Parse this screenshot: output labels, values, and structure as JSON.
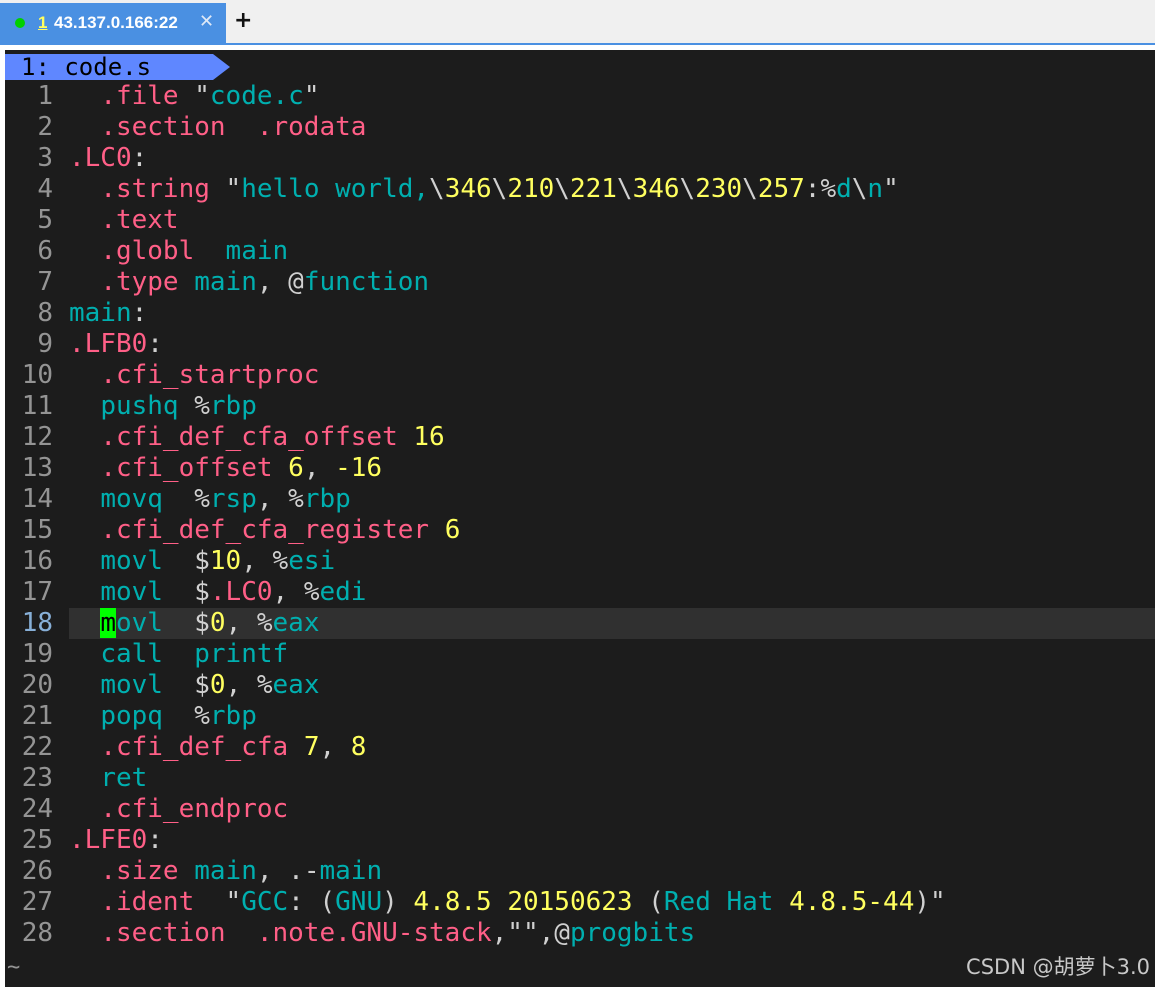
{
  "tab": {
    "number": "1",
    "host": "43.137.0.166:22",
    "close_glyph": "✕",
    "new_tab_glyph": "+",
    "status_color": "#00d000"
  },
  "buffer": {
    "name": "1: code.s"
  },
  "editor": {
    "current_line": 18,
    "empty_line_marker": "~"
  },
  "lines": [
    {
      "n": "1",
      "segs": [
        [
          "  ",
          "plain"
        ],
        [
          ".file",
          "dir"
        ],
        [
          " \"",
          "plain"
        ],
        [
          "code.c",
          "str"
        ],
        [
          "\"",
          "plain"
        ]
      ]
    },
    {
      "n": "2",
      "segs": [
        [
          "  ",
          "plain"
        ],
        [
          ".section  .rodata",
          "dir"
        ]
      ]
    },
    {
      "n": "3",
      "segs": [
        [
          ".LC0",
          "lbl"
        ],
        [
          ":",
          "plain"
        ]
      ]
    },
    {
      "n": "4",
      "segs": [
        [
          "  ",
          "plain"
        ],
        [
          ".string",
          "dir"
        ],
        [
          " \"",
          "plain"
        ],
        [
          "hello world,",
          "str"
        ],
        [
          "\\",
          "plain"
        ],
        [
          "346",
          "num"
        ],
        [
          "\\",
          "plain"
        ],
        [
          "210",
          "num"
        ],
        [
          "\\",
          "plain"
        ],
        [
          "221",
          "num"
        ],
        [
          "\\",
          "plain"
        ],
        [
          "346",
          "num"
        ],
        [
          "\\",
          "plain"
        ],
        [
          "230",
          "num"
        ],
        [
          "\\",
          "plain"
        ],
        [
          "257",
          "num"
        ],
        [
          ":%",
          "plain"
        ],
        [
          "d",
          "str"
        ],
        [
          "\\",
          "plain"
        ],
        [
          "n",
          "str"
        ],
        [
          "\"",
          "plain"
        ]
      ]
    },
    {
      "n": "5",
      "segs": [
        [
          "  ",
          "plain"
        ],
        [
          ".text",
          "dir"
        ]
      ]
    },
    {
      "n": "6",
      "segs": [
        [
          "  ",
          "plain"
        ],
        [
          ".globl",
          "dir"
        ],
        [
          "  ",
          "plain"
        ],
        [
          "main",
          "str"
        ]
      ]
    },
    {
      "n": "7",
      "segs": [
        [
          "  ",
          "plain"
        ],
        [
          ".type",
          "dir"
        ],
        [
          " ",
          "plain"
        ],
        [
          "main",
          "str"
        ],
        [
          ", @",
          "plain"
        ],
        [
          "function",
          "str"
        ]
      ]
    },
    {
      "n": "8",
      "segs": [
        [
          "main",
          "str"
        ],
        [
          ":",
          "plain"
        ]
      ]
    },
    {
      "n": "9",
      "segs": [
        [
          ".LFB0",
          "lbl"
        ],
        [
          ":",
          "plain"
        ]
      ]
    },
    {
      "n": "10",
      "segs": [
        [
          "  ",
          "plain"
        ],
        [
          ".cfi_startproc",
          "dir"
        ]
      ]
    },
    {
      "n": "11",
      "segs": [
        [
          "  ",
          "plain"
        ],
        [
          "pushq",
          "ins"
        ],
        [
          " %",
          "plain"
        ],
        [
          "rbp",
          "reg"
        ]
      ]
    },
    {
      "n": "12",
      "segs": [
        [
          "  ",
          "plain"
        ],
        [
          ".cfi_def_cfa_offset",
          "dir"
        ],
        [
          " ",
          "plain"
        ],
        [
          "16",
          "num"
        ]
      ]
    },
    {
      "n": "13",
      "segs": [
        [
          "  ",
          "plain"
        ],
        [
          ".cfi_offset",
          "dir"
        ],
        [
          " ",
          "plain"
        ],
        [
          "6",
          "num"
        ],
        [
          ", ",
          "plain"
        ],
        [
          "-16",
          "num"
        ]
      ]
    },
    {
      "n": "14",
      "segs": [
        [
          "  ",
          "plain"
        ],
        [
          "movq",
          "ins"
        ],
        [
          "  %",
          "plain"
        ],
        [
          "rsp",
          "reg"
        ],
        [
          ", %",
          "plain"
        ],
        [
          "rbp",
          "reg"
        ]
      ]
    },
    {
      "n": "15",
      "segs": [
        [
          "  ",
          "plain"
        ],
        [
          ".cfi_def_cfa_register",
          "dir"
        ],
        [
          " ",
          "plain"
        ],
        [
          "6",
          "num"
        ]
      ]
    },
    {
      "n": "16",
      "segs": [
        [
          "  ",
          "plain"
        ],
        [
          "movl",
          "ins"
        ],
        [
          "  $",
          "plain"
        ],
        [
          "10",
          "num"
        ],
        [
          ", %",
          "plain"
        ],
        [
          "esi",
          "reg"
        ]
      ]
    },
    {
      "n": "17",
      "segs": [
        [
          "  ",
          "plain"
        ],
        [
          "movl",
          "ins"
        ],
        [
          "  $",
          "plain"
        ],
        [
          ".LC0",
          "lbl"
        ],
        [
          ", %",
          "plain"
        ],
        [
          "edi",
          "reg"
        ]
      ]
    },
    {
      "n": "18",
      "segs": [
        [
          "  ",
          "plain"
        ],
        [
          "m",
          "cursor"
        ],
        [
          "ovl",
          "ins"
        ],
        [
          "  $",
          "plain"
        ],
        [
          "0",
          "num"
        ],
        [
          ", %",
          "plain"
        ],
        [
          "eax",
          "reg"
        ]
      ]
    },
    {
      "n": "19",
      "segs": [
        [
          "  ",
          "plain"
        ],
        [
          "call",
          "ins"
        ],
        [
          "  ",
          "plain"
        ],
        [
          "printf",
          "str"
        ]
      ]
    },
    {
      "n": "20",
      "segs": [
        [
          "  ",
          "plain"
        ],
        [
          "movl",
          "ins"
        ],
        [
          "  $",
          "plain"
        ],
        [
          "0",
          "num"
        ],
        [
          ", %",
          "plain"
        ],
        [
          "eax",
          "reg"
        ]
      ]
    },
    {
      "n": "21",
      "segs": [
        [
          "  ",
          "plain"
        ],
        [
          "popq",
          "ins"
        ],
        [
          "  %",
          "plain"
        ],
        [
          "rbp",
          "reg"
        ]
      ]
    },
    {
      "n": "22",
      "segs": [
        [
          "  ",
          "plain"
        ],
        [
          ".cfi_def_cfa",
          "dir"
        ],
        [
          " ",
          "plain"
        ],
        [
          "7",
          "num"
        ],
        [
          ", ",
          "plain"
        ],
        [
          "8",
          "num"
        ]
      ]
    },
    {
      "n": "23",
      "segs": [
        [
          "  ",
          "plain"
        ],
        [
          "ret",
          "ins"
        ]
      ]
    },
    {
      "n": "24",
      "segs": [
        [
          "  ",
          "plain"
        ],
        [
          ".cfi_endproc",
          "dir"
        ]
      ]
    },
    {
      "n": "25",
      "segs": [
        [
          ".LFE0",
          "lbl"
        ],
        [
          ":",
          "plain"
        ]
      ]
    },
    {
      "n": "26",
      "segs": [
        [
          "  ",
          "plain"
        ],
        [
          ".size",
          "dir"
        ],
        [
          " ",
          "plain"
        ],
        [
          "main",
          "str"
        ],
        [
          ", .-",
          "plain"
        ],
        [
          "main",
          "str"
        ]
      ]
    },
    {
      "n": "27",
      "segs": [
        [
          "  ",
          "plain"
        ],
        [
          ".ident",
          "dir"
        ],
        [
          "  \"",
          "plain"
        ],
        [
          "GCC",
          "str"
        ],
        [
          ": (",
          "plain"
        ],
        [
          "GNU",
          "str"
        ],
        [
          ") ",
          "plain"
        ],
        [
          "4.8.5 20150623",
          "num"
        ],
        [
          " (",
          "plain"
        ],
        [
          "Red Hat",
          "str"
        ],
        [
          " ",
          "plain"
        ],
        [
          "4.8.5-44",
          "num"
        ],
        [
          ")\"",
          "plain"
        ]
      ]
    },
    {
      "n": "28",
      "segs": [
        [
          "  ",
          "plain"
        ],
        [
          ".section  .note.GNU-stack",
          "dir"
        ],
        [
          ",\"\",@",
          "plain"
        ],
        [
          "progbits",
          "str"
        ]
      ]
    }
  ],
  "watermark": "CSDN @胡萝卜3.0",
  "colors": {
    "terminal_bg": "#1c1c1c",
    "tab_active": "#4a90e2",
    "buffer_label": "#5f87ff",
    "directive": "#ff5f87",
    "identifier": "#00afaf",
    "number": "#ffff5f",
    "cursor": "#00ff00"
  }
}
